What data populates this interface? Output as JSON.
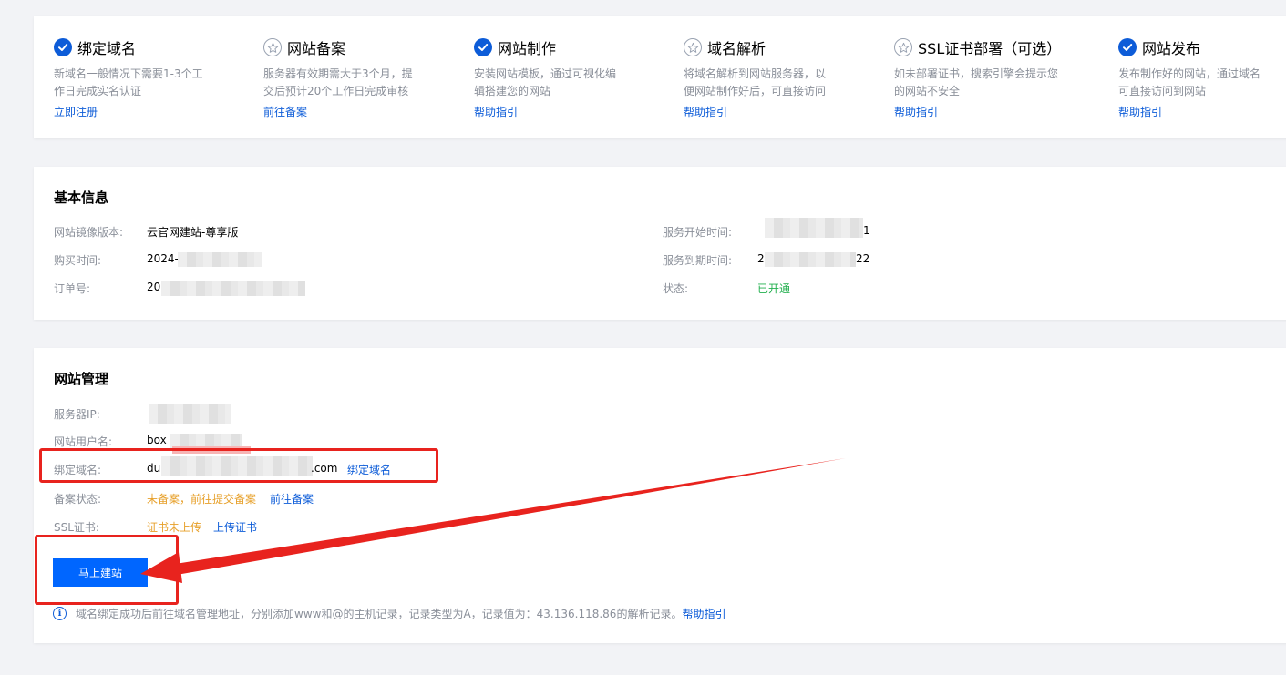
{
  "steps": [
    {
      "title": "绑定域名",
      "status_icon": "check-circle-icon",
      "desc": "新域名一般情况下需要1-3个工\n作日完成实名认证",
      "link": "立即注册"
    },
    {
      "title": "网站备案",
      "status_icon": "star-outline-icon",
      "desc": "服务器有效期需大于3个月，提\n交后预计20个工作日完成审核",
      "link": "前往备案"
    },
    {
      "title": "网站制作",
      "status_icon": "check-circle-icon",
      "desc": "安装网站模板，通过可视化编\n辑搭建您的网站",
      "link": "帮助指引"
    },
    {
      "title": "域名解析",
      "status_icon": "star-outline-icon",
      "desc": "将域名解析到网站服务器，以\n便网站制作好后，可直接访问",
      "link": "帮助指引"
    },
    {
      "title": "SSL证书部署（可选）",
      "status_icon": "star-outline-icon",
      "desc": "如未部署证书，搜索引擎会提示您\n的网站不安全",
      "link": "帮助指引"
    },
    {
      "title": "网站发布",
      "status_icon": "check-circle-icon",
      "desc": "发布制作好的网站，通过域名\n可直接访问到网站",
      "link": "帮助指引"
    }
  ],
  "basic_info": {
    "title": "基本信息",
    "image_version_label": "网站镜像版本:",
    "image_version_value": "云官网建站-尊享版",
    "purchase_time_label": "购买时间:",
    "purchase_time_value": "2024-",
    "order_no_label": "订单号:",
    "order_no_value": "20",
    "service_start_label": "服务开始时间:",
    "service_start_value": "1",
    "service_end_label": "服务到期时间:",
    "service_end_value_prefix": "2",
    "service_end_value_suffix": "22",
    "status_label": "状态:",
    "status_value": "已开通"
  },
  "site_mgmt": {
    "title": "网站管理",
    "server_ip_label": "服务器IP:",
    "server_ip_value": "",
    "username_label": "网站用户名:",
    "username_value": "box",
    "domain_label": "绑定域名:",
    "domain_value_prefix": "du",
    "domain_value_suffix": ".com",
    "domain_link": "绑定域名",
    "icp_label": "备案状态:",
    "icp_value": "未备案，前往提交备案",
    "icp_link": "前往备案",
    "ssl_label": "SSL证书:",
    "ssl_value": "证书未上传",
    "ssl_link": "上传证书",
    "build_button": "马上建站",
    "info_text": "域名绑定成功后前往域名管理地址，分别添加www和@的主机记录，记录类型为A，记录值为：43.136.118.86的解析记录。",
    "info_link": "帮助指引"
  },
  "colors": {
    "primary": "#0d5cd8",
    "button": "#0066ff",
    "annotation": "#e8231e",
    "success": "#23b04f",
    "warning": "#e7a02a"
  }
}
